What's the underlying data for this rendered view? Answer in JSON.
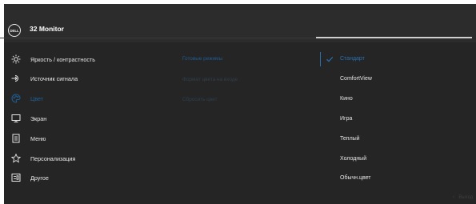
{
  "header": {
    "logo_text": "DELL",
    "title": "32 Monitor"
  },
  "menu": {
    "items": [
      {
        "label": "Яркость / контрастность",
        "icon": "brightness-icon"
      },
      {
        "label": "Источник сигнала",
        "icon": "input-source-icon"
      },
      {
        "label": "Цвет",
        "icon": "color-palette-icon",
        "active": true
      },
      {
        "label": "Экран",
        "icon": "display-icon"
      },
      {
        "label": "Меню",
        "icon": "menu-icon"
      },
      {
        "label": "Персонализация",
        "icon": "star-icon"
      },
      {
        "label": "Другое",
        "icon": "other-icon"
      }
    ]
  },
  "submenu": {
    "items": [
      {
        "label": "Готовые режимы",
        "state": "active"
      },
      {
        "label": "Формат цвета на входе",
        "state": "dim"
      },
      {
        "label": "Сбросить цвет",
        "state": "dim"
      }
    ]
  },
  "options": {
    "items": [
      {
        "label": "Стандарт",
        "selected": true
      },
      {
        "label": "ComfortView"
      },
      {
        "label": "Кино"
      },
      {
        "label": "Игра"
      },
      {
        "label": "Теплый"
      },
      {
        "label": "Холодный"
      },
      {
        "label": "Обычн.цвет"
      }
    ]
  },
  "footer": {
    "exit_label": "Выход"
  },
  "colors": {
    "background": "#252525",
    "header": "#2c2c2c",
    "accent": "#2770b1",
    "text": "#e6e6e6"
  }
}
